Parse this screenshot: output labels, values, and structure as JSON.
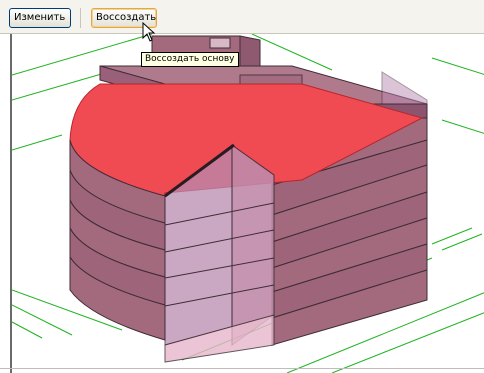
{
  "toolbar": {
    "edit_label": "Изменить",
    "recreate_label": "Воссоздать"
  },
  "tooltip": {
    "text": "Воссоздать основу"
  },
  "colors": {
    "building_fill": "#a36a7e",
    "building_edge": "#3f2c36",
    "highlight_floor": "#f04a52",
    "glass_core": "#b98bb0",
    "grid_lines": "#21b321",
    "toolbar_bg": "#f4f3ee"
  }
}
